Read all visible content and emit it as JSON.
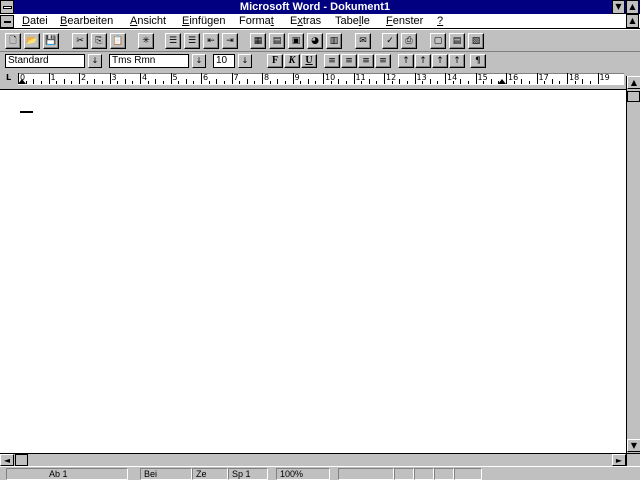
{
  "window": {
    "title": "Microsoft Word - Dokument1",
    "minimize_glyph": "▼",
    "maximize_glyph": "▲"
  },
  "menu": {
    "items": [
      {
        "label": "Datei",
        "accel": "D"
      },
      {
        "label": "Bearbeiten",
        "accel": "B"
      },
      {
        "label": "Ansicht",
        "accel": "A"
      },
      {
        "label": "Einfügen",
        "accel": "E"
      },
      {
        "label": "Format",
        "accel": "t"
      },
      {
        "label": "Extras",
        "accel": "x"
      },
      {
        "label": "Tabelle",
        "accel": "l"
      },
      {
        "label": "Fenster",
        "accel": "F"
      },
      {
        "label": "?",
        "accel": "?"
      }
    ],
    "restore_glyph": "▲"
  },
  "toolbar": {
    "buttons": [
      {
        "name": "new-document-button",
        "icon": "new-document-icon",
        "glyph": "🗋"
      },
      {
        "name": "open-button",
        "icon": "folder-open-icon",
        "glyph": "📂"
      },
      {
        "name": "save-button",
        "icon": "floppy-disk-icon",
        "glyph": "💾"
      },
      {
        "name": "cut-button",
        "icon": "scissors-icon",
        "glyph": "✂"
      },
      {
        "name": "copy-button",
        "icon": "copy-icon",
        "glyph": "⎘"
      },
      {
        "name": "paste-button",
        "icon": "clipboard-icon",
        "glyph": "📋"
      },
      {
        "name": "format-painter-button",
        "icon": "brush-icon",
        "glyph": "✳"
      },
      {
        "name": "numbered-list-button",
        "icon": "numbered-list-icon",
        "glyph": "☰"
      },
      {
        "name": "bullet-list-button",
        "icon": "bullet-list-icon",
        "glyph": "☰"
      },
      {
        "name": "decrease-indent-button",
        "icon": "outdent-icon",
        "glyph": "⇤"
      },
      {
        "name": "increase-indent-button",
        "icon": "indent-icon",
        "glyph": "⇥"
      },
      {
        "name": "insert-table-button",
        "icon": "table-icon",
        "glyph": "▦"
      },
      {
        "name": "columns-button",
        "icon": "columns-icon",
        "glyph": "▤"
      },
      {
        "name": "insert-frame-button",
        "icon": "frame-icon",
        "glyph": "▣"
      },
      {
        "name": "insert-drawing-button",
        "icon": "drawing-icon",
        "glyph": "◕"
      },
      {
        "name": "insert-chart-button",
        "icon": "chart-icon",
        "glyph": "▥"
      },
      {
        "name": "envelope-button",
        "icon": "envelope-icon",
        "glyph": "✉"
      },
      {
        "name": "spelling-button",
        "icon": "spell-check-icon",
        "glyph": "✓"
      },
      {
        "name": "print-button",
        "icon": "printer-icon",
        "glyph": "⎙"
      },
      {
        "name": "zoom-whole-page-button",
        "icon": "whole-page-icon",
        "glyph": "▢"
      },
      {
        "name": "zoom-100-button",
        "icon": "normal-view-icon",
        "glyph": "▤"
      },
      {
        "name": "zoom-page-width-button",
        "icon": "page-width-icon",
        "glyph": "▧"
      }
    ]
  },
  "formatting": {
    "style_value": "Standard",
    "font_value": "Tms Rmn",
    "size_value": "10",
    "dropdown_glyph": "↓",
    "bold_label": "F",
    "italic_label": "K",
    "underline_label": "U",
    "align_glyph": "≡",
    "tab_glyphs": [
      "↑",
      "↑",
      "↑",
      "↑"
    ],
    "show_marks_label": "¶"
  },
  "ruler": {
    "numbers": [
      "0",
      "1",
      "2",
      "3",
      "4",
      "5",
      "6",
      "7",
      "8",
      "9",
      "10",
      "11",
      "12",
      "13",
      "14",
      "15",
      "16",
      "17",
      "18",
      "19"
    ],
    "marker_label": "L"
  },
  "scrollbars": {
    "up_glyph": "▲",
    "down_glyph": "▼",
    "left_glyph": "◄",
    "right_glyph": "►"
  },
  "status": {
    "page": "Ab 1",
    "at": "Bei",
    "line": "Ze",
    "column": "Sp 1",
    "zoom": "100%"
  }
}
